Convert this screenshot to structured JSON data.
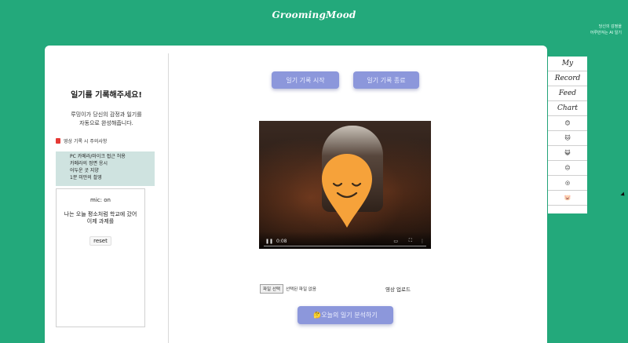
{
  "app": {
    "brand": "GroomingMood",
    "top_right_note": [
      "당신의 감정을",
      "어루만져는 AI 일기"
    ]
  },
  "left_panel": {
    "title": "일기를 기록해주세요!",
    "description": [
      "루밍이가 당신의 감정과 일기를",
      "자동으로 완성해줍니다."
    ],
    "warning_label": "영상 기록 시 주의사항",
    "cautions": [
      "PC 카메라/마이크 접근 허용",
      "카메라의 정면 응시",
      "어두운 곳 지양",
      "1분 미만의 촬영"
    ],
    "mic_status": "mic: on",
    "transcript": [
      "나는 오늘 평소처럼 학교에 갔어",
      "이제 과제를"
    ],
    "reset_label": "reset"
  },
  "main": {
    "start_button": "일기 기록 시작",
    "stop_button": "일기 기록 종료",
    "video": {
      "time": "0:08",
      "play_icon": "play-icon",
      "volume_icon": "volume-icon",
      "fullscreen_icon": "fullscreen-icon",
      "more_icon": "more-icon"
    },
    "file_button": "파일 선택",
    "file_status": "선택된 파일 없음",
    "upload_label": "영상 업로드",
    "analyze_button": "🤔오늘의 일기 분석하기"
  },
  "sidenav": {
    "items": [
      {
        "label": "My",
        "type": "text"
      },
      {
        "label": "Record",
        "type": "text"
      },
      {
        "label": "Feed",
        "type": "text"
      },
      {
        "label": "Chart",
        "type": "text"
      },
      {
        "icon": "happy-emoji-icon",
        "glyph": "😊",
        "type": "icon"
      },
      {
        "icon": "blue-emoji-icon",
        "glyph": "🐱",
        "type": "icon"
      },
      {
        "icon": "red-emoji-icon",
        "glyph": "😺",
        "type": "icon"
      },
      {
        "icon": "green-emoji-icon",
        "glyph": "😐",
        "type": "icon"
      },
      {
        "icon": "spiral-emoji-icon",
        "glyph": "◎",
        "type": "icon"
      },
      {
        "icon": "pink-emoji-icon",
        "glyph": "🐷",
        "type": "icon"
      }
    ]
  },
  "colors": {
    "background": "#23a97b",
    "button_primary": "#8c97db",
    "caution_bg": "#cfe3e0",
    "emoji_overlay": "#f6a23a"
  }
}
